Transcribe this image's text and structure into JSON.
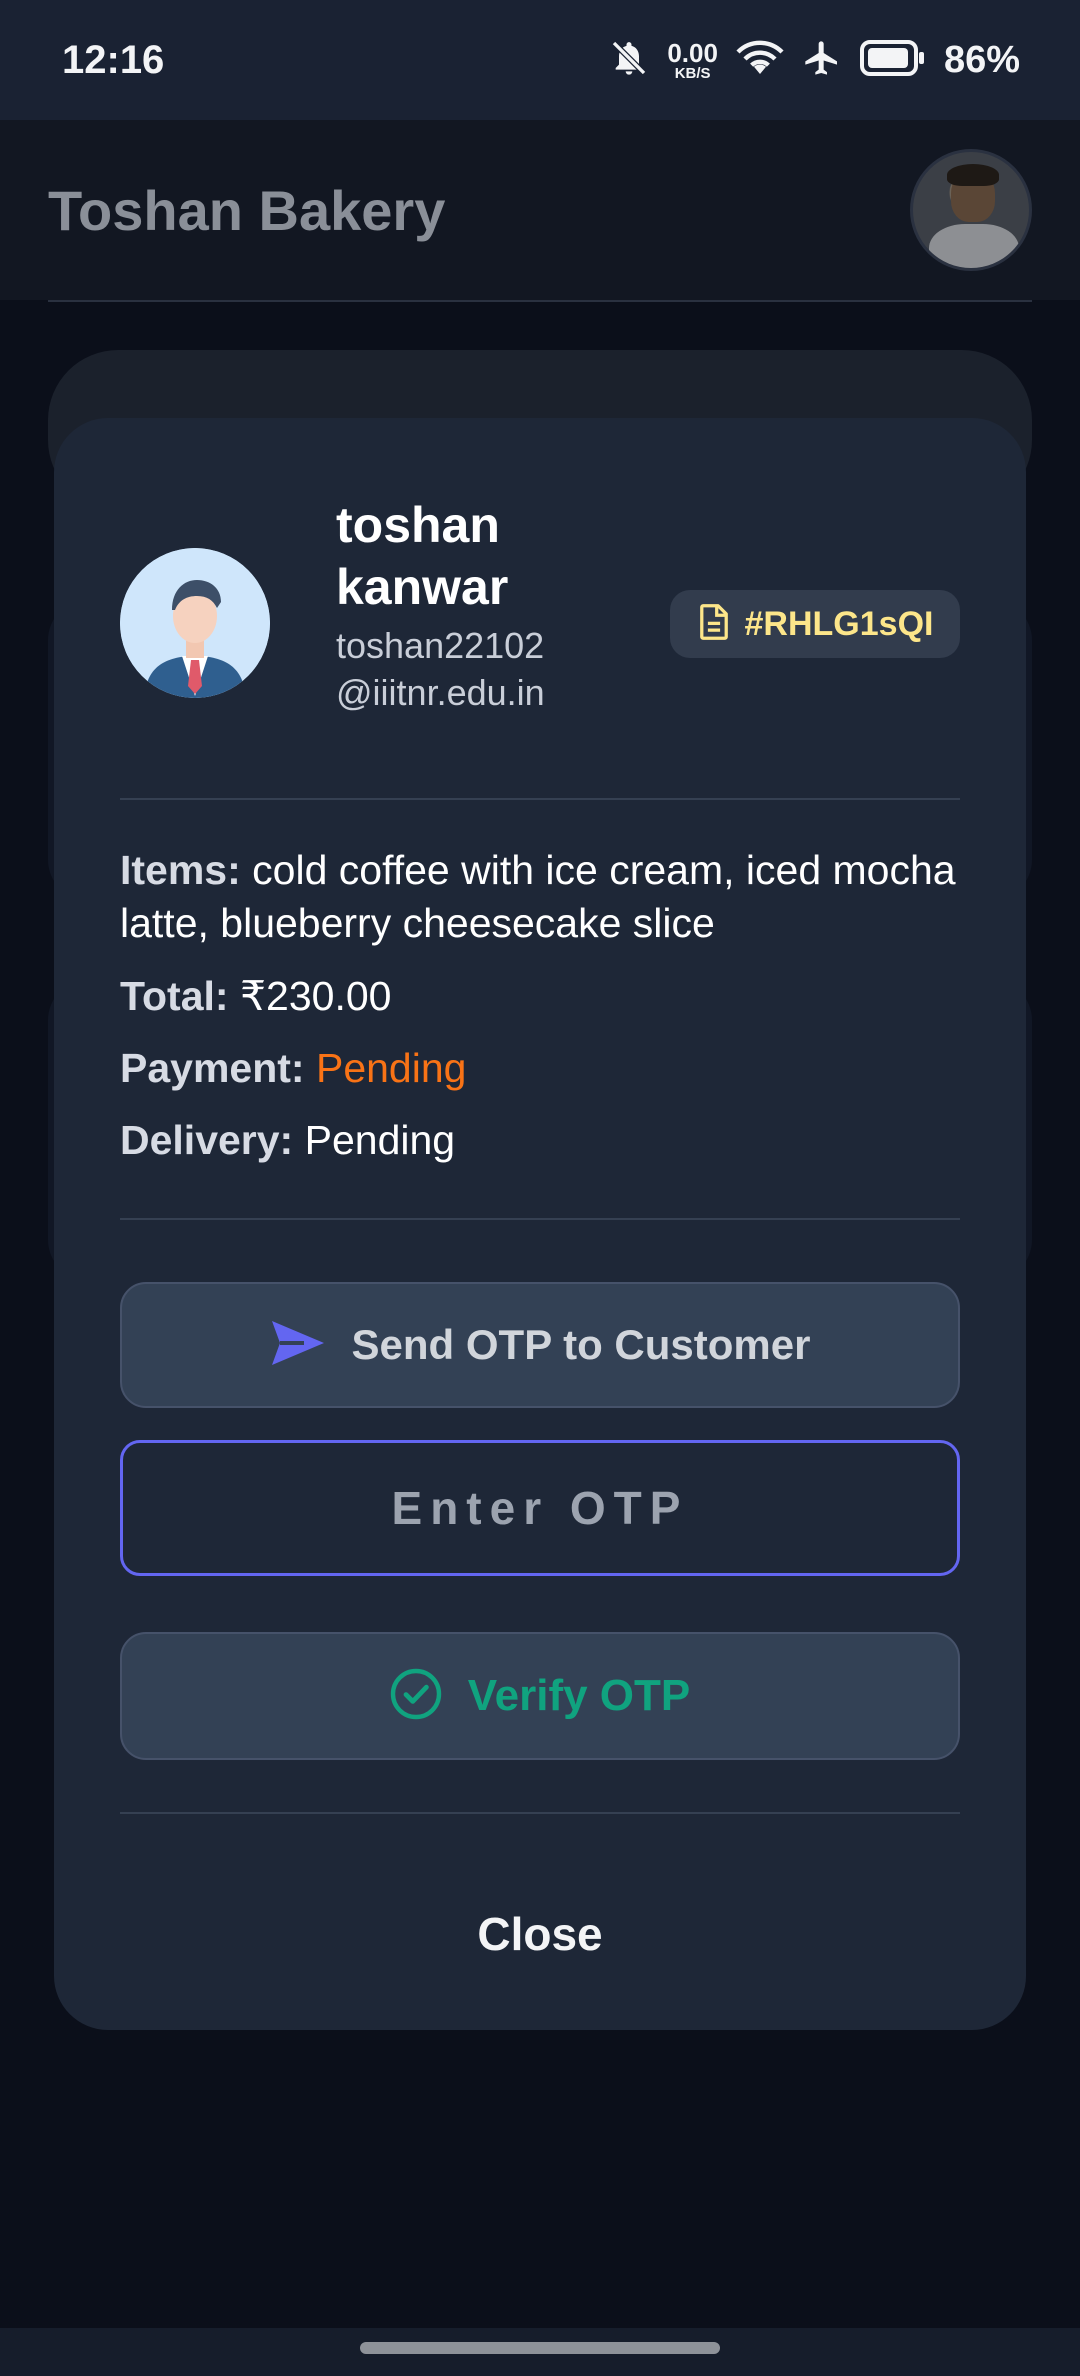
{
  "status_bar": {
    "time": "12:16",
    "net_speed_value": "0.00",
    "net_speed_unit": "KB/S",
    "battery": "86%",
    "icons": [
      "bell-off-icon",
      "wifi-icon",
      "airplane-icon",
      "battery-icon"
    ]
  },
  "header": {
    "title": "Toshan Bakery",
    "avatar": "profile-photo"
  },
  "modal": {
    "user": {
      "name": "toshan kanwar",
      "email": "toshan22102@iiitnr.edu.in"
    },
    "order_id": "#RHLG1sQI",
    "details": {
      "items_label": "Items:",
      "items_value": "cold coffee with ice cream, iced mocha latte, blueberry cheesecake slice",
      "total_label": "Total:",
      "total_value": "₹230.00",
      "payment_label": "Payment:",
      "payment_value": "Pending",
      "delivery_label": "Delivery:",
      "delivery_value": "Pending"
    },
    "send_otp_label": "Send OTP to Customer",
    "otp_placeholder": "Enter OTP",
    "otp_value": "",
    "verify_label": "Verify OTP",
    "close_label": "Close"
  },
  "colors": {
    "accent": "#6366f1",
    "payment_pending": "#f97316",
    "verify": "#10a37f",
    "badge_text": "#fde68a",
    "modal_bg": "#1e2737"
  }
}
